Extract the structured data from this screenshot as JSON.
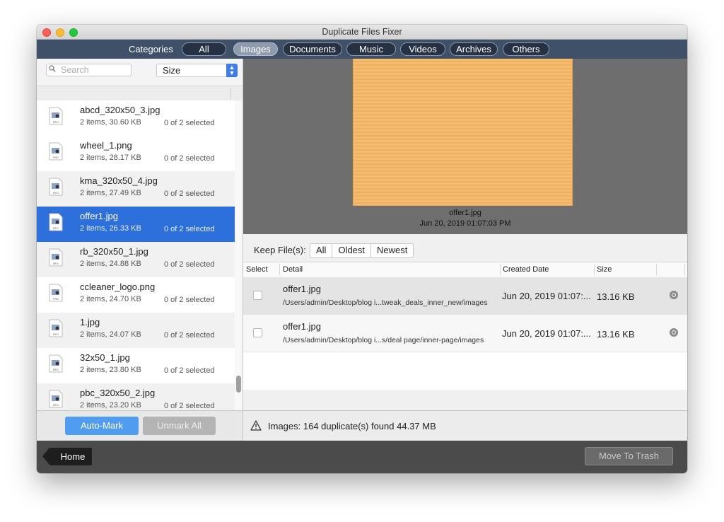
{
  "window": {
    "title": "Duplicate Files Fixer"
  },
  "categories": {
    "label": "Categories",
    "tabs": [
      {
        "label": "All",
        "active": false
      },
      {
        "label": "Images",
        "active": true
      },
      {
        "label": "Documents",
        "active": false
      },
      {
        "label": "Music",
        "active": false
      },
      {
        "label": "Videos",
        "active": false
      },
      {
        "label": "Archives",
        "active": false
      },
      {
        "label": "Others",
        "active": false
      }
    ]
  },
  "sidebar": {
    "search_placeholder": "Search",
    "sort_value": "Size",
    "files": [
      {
        "name": "abcd_320x50_3.jpg",
        "meta": "2 items, 30.60 KB",
        "selected_text": "0 of 2 selected",
        "type": "JPEG",
        "selected": false
      },
      {
        "name": "wheel_1.png",
        "meta": "2 items, 28.17 KB",
        "selected_text": "0 of 2 selected",
        "type": "PNG",
        "selected": false
      },
      {
        "name": "kma_320x50_4.jpg",
        "meta": "2 items, 27.49 KB",
        "selected_text": "0 of 2 selected",
        "type": "JPEG",
        "selected": false
      },
      {
        "name": "offer1.jpg",
        "meta": "2 items, 26.33 KB",
        "selected_text": "0 of 2 selected",
        "type": "JPEG",
        "selected": true
      },
      {
        "name": "rb_320x50_1.jpg",
        "meta": "2 items, 24.88 KB",
        "selected_text": "0 of 2 selected",
        "type": "JPEG",
        "selected": false
      },
      {
        "name": "ccleaner_logo.png",
        "meta": "2 items, 24.70 KB",
        "selected_text": "0 of 2 selected",
        "type": "PNG",
        "selected": false
      },
      {
        "name": "1.jpg",
        "meta": "2 items, 24.07 KB",
        "selected_text": "0 of 2 selected",
        "type": "JPEG",
        "selected": false
      },
      {
        "name": "32x50_1.jpg",
        "meta": "2 items, 23.80 KB",
        "selected_text": "0 of 2 selected",
        "type": "JPEG",
        "selected": false
      },
      {
        "name": "pbc_320x50_2.jpg",
        "meta": "2 items, 23.20 KB",
        "selected_text": "0 of 2 selected",
        "type": "JPEG",
        "selected": false
      }
    ],
    "auto_mark_label": "Auto-Mark",
    "unmark_all_label": "Unmark All"
  },
  "preview": {
    "file_name": "offer1.jpg",
    "file_date": "Jun 20, 2019 01:07:03 PM",
    "image_color": "#f5bb6e"
  },
  "keep": {
    "label": "Keep File(s):",
    "options": [
      "All",
      "Oldest",
      "Newest"
    ]
  },
  "table": {
    "headers": {
      "select": "Select",
      "detail": "Detail",
      "created": "Created Date",
      "size": "Size"
    },
    "rows": [
      {
        "name": "offer1.jpg",
        "path": "/Users/admin/Desktop/blog i...tweak_deals_inner_new/images",
        "date": "Jun 20, 2019 01:07:...",
        "size": "13.16 KB"
      },
      {
        "name": "offer1.jpg",
        "path": "/Users/admin/Desktop/blog i...s/deal page/inner-page/images",
        "date": "Jun 20, 2019 01:07:...",
        "size": "13.16 KB"
      }
    ]
  },
  "status": {
    "text": "Images: 164 duplicate(s) found 44.37 MB"
  },
  "footer": {
    "home_label": "Home",
    "trash_label": "Move To Trash"
  },
  "colors": {
    "accent": "#2d6fdb",
    "tabbar": "#3f5169",
    "auto_mark": "#4f9cf1"
  }
}
